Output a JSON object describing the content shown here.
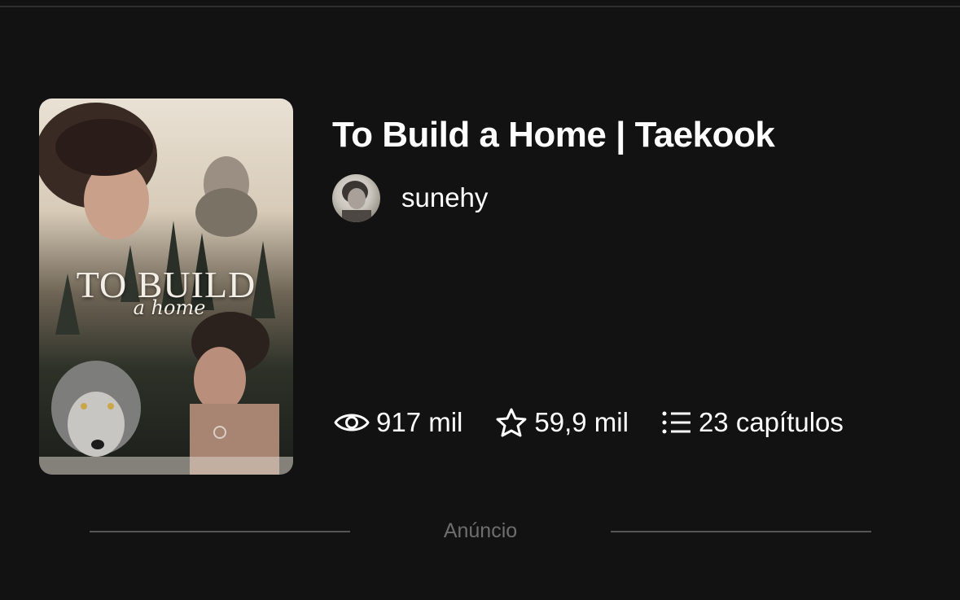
{
  "story": {
    "title": "To Build a Home | Taekook",
    "cover_title": "TO BUILD",
    "cover_subtitle": "a home"
  },
  "author": {
    "name": "sunehy"
  },
  "stats": {
    "reads": "917 mil",
    "votes": "59,9 mil",
    "chapters": "23 capítulos"
  },
  "ad": {
    "label": "Anúncio"
  },
  "icons": {
    "reads": "eye-icon",
    "votes": "star-icon",
    "chapters": "list-icon"
  },
  "colors": {
    "background": "#121212",
    "text": "#ffffff",
    "muted": "#6e6e6e",
    "divider": "#555555"
  }
}
